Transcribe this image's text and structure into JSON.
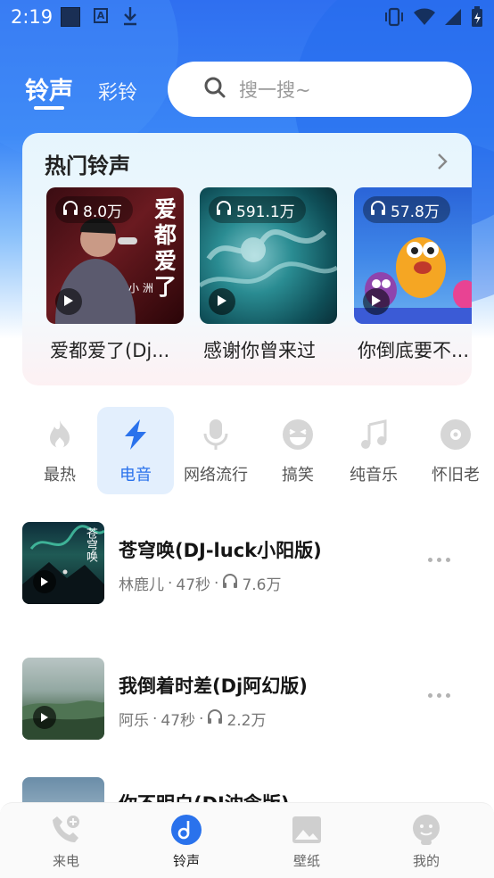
{
  "status_bar": {
    "time": "2:19"
  },
  "header": {
    "tabs": [
      {
        "label": "铃声",
        "active": true
      },
      {
        "label": "彩铃",
        "active": false
      }
    ],
    "search_placeholder": "搜一搜~"
  },
  "hot": {
    "title": "热门铃声",
    "items": [
      {
        "plays": "8.0万",
        "name": "爱都爱了(Dj...",
        "cover_text_lines": [
          "爱",
          "都",
          "爱",
          "了"
        ],
        "cover_subtext": "小 洲"
      },
      {
        "plays": "591.1万",
        "name": "感谢你曾来过"
      },
      {
        "plays": "57.8万",
        "name": "你倒底要不..."
      }
    ]
  },
  "categories": [
    {
      "label": "最热",
      "icon": "flame-icon",
      "active": false
    },
    {
      "label": "电音",
      "icon": "lightning-icon",
      "active": true
    },
    {
      "label": "网络流行",
      "icon": "microphone-icon",
      "active": false
    },
    {
      "label": "搞笑",
      "icon": "laughing-face-icon",
      "active": false
    },
    {
      "label": "纯音乐",
      "icon": "music-note-icon",
      "active": false
    },
    {
      "label": "怀旧老",
      "icon": "vinyl-disc-icon",
      "active": false
    }
  ],
  "songs": [
    {
      "title": "苍穹唤(DJ-luck小阳版)",
      "artist": "林鹿儿",
      "duration": "47秒",
      "plays": "7.6万",
      "cover_text": "苍穹唤"
    },
    {
      "title": "我倒着时差(Dj阿幻版)",
      "artist": "阿乐",
      "duration": "47秒",
      "plays": "2.2万"
    },
    {
      "title": "你不明白(DJ沈念版)",
      "artist": "",
      "duration": "",
      "plays": ""
    }
  ],
  "meta_separator": "·",
  "bottom_nav": [
    {
      "label": "来电",
      "icon": "phone-call-icon",
      "active": false
    },
    {
      "label": "铃声",
      "icon": "music-disc-icon",
      "active": true
    },
    {
      "label": "壁纸",
      "icon": "image-icon",
      "active": false
    },
    {
      "label": "我的",
      "icon": "profile-face-icon",
      "active": false
    }
  ],
  "colors": {
    "accent": "#2a72ec",
    "header_blue": "#2f6ff0"
  }
}
